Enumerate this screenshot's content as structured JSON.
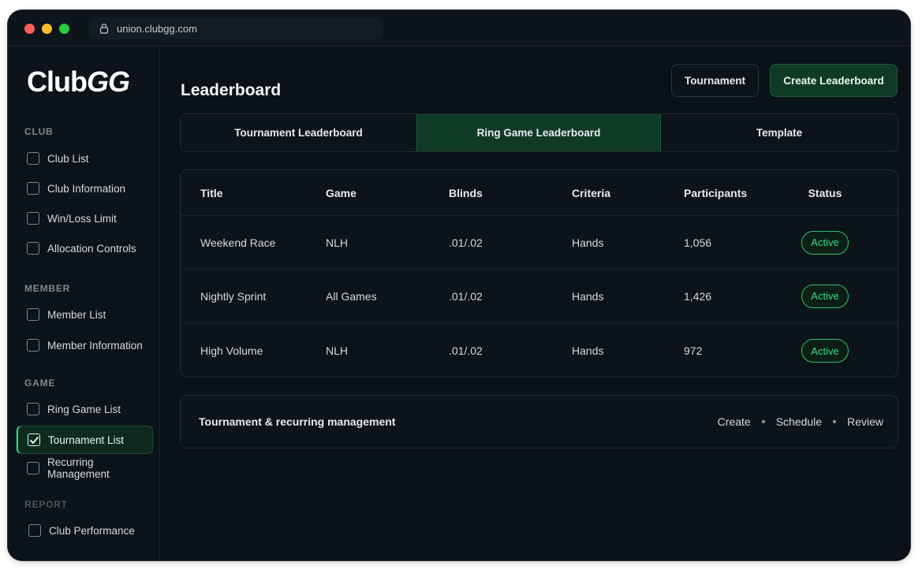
{
  "browser": {
    "url": "union.clubgg.com"
  },
  "brand": {
    "logo_club": "Club",
    "logo_gg": "GG"
  },
  "sidebar": {
    "sections": [
      {
        "label": "CLUB",
        "items": [
          "Club List",
          "Club Information",
          "Win/Loss Limit",
          "Allocation Controls"
        ]
      },
      {
        "label": "MEMBER",
        "items": [
          "Member List",
          "Member Information"
        ]
      },
      {
        "label": "GAME",
        "items": [
          "Ring Game List",
          "Tournament List",
          "Recurring Management"
        ]
      },
      {
        "label": "REPORT",
        "items": [
          "Club Performance"
        ]
      }
    ],
    "active_item": "Tournament List"
  },
  "header": {
    "title": "Leaderboard",
    "secondary_button": "Tournament",
    "primary_button": "Create Leaderboard"
  },
  "tabs": {
    "items": [
      "Tournament Leaderboard",
      "Ring Game Leaderboard",
      "Template"
    ],
    "active": "Ring Game Leaderboard"
  },
  "table": {
    "columns": [
      "Title",
      "Game",
      "Blinds",
      "Criteria",
      "Participants",
      "Status"
    ],
    "rows": [
      {
        "title": "Weekend Race",
        "game": "NLH",
        "blinds": ".01/.02",
        "criteria": "Hands",
        "participants": "1,056",
        "status": "Active"
      },
      {
        "title": "Nightly Sprint",
        "game": "All Games",
        "blinds": ".01/.02",
        "criteria": "Hands",
        "participants": "1,426",
        "status": "Active"
      },
      {
        "title": "High Volume",
        "game": "NLH",
        "blinds": ".01/.02",
        "criteria": "Hands",
        "participants": "972",
        "status": "Active"
      }
    ]
  },
  "footer": {
    "title": "Tournament & recurring management",
    "links": [
      "Create",
      "Schedule",
      "Review"
    ]
  },
  "colors": {
    "accent_green": "#3ddc84",
    "active_bg": "#0f3a26",
    "window_bg": "#0b1118"
  }
}
